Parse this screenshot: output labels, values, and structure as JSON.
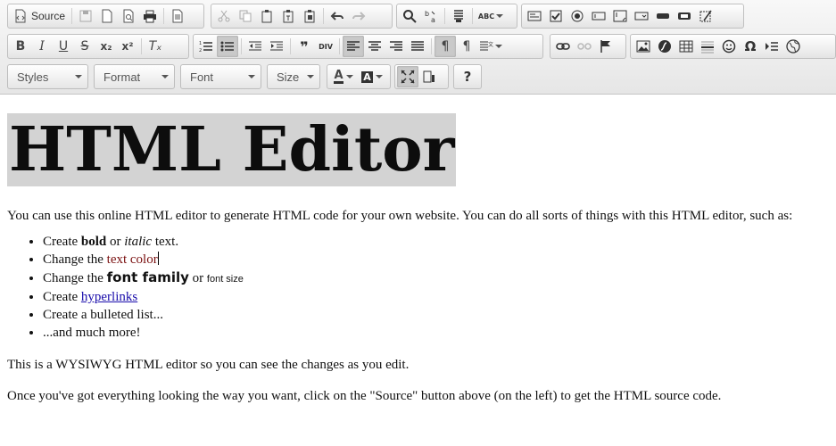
{
  "toolbar": {
    "source_label": "Source",
    "styles_label": "Styles",
    "format_label": "Format",
    "font_label": "Font",
    "size_label": "Size",
    "help_label": "?",
    "text_color_glyph": "A",
    "bg_color_glyph": "A",
    "omega_glyph": "Ω",
    "bold_glyph": "B",
    "italic_glyph": "I",
    "underline_glyph": "U",
    "strike_glyph": "S",
    "subscript_glyph": "x₂",
    "superscript_glyph": "x²",
    "removeformat_glyph": "Tₓ",
    "quote_glyph": "❞",
    "div_glyph": "DIV",
    "spellcheck_glyph": "ABC",
    "ltr_glyph": "¶",
    "rtl_glyph": "¶"
  },
  "content": {
    "heading": "HTML Editor",
    "intro": "You can use this online HTML editor to generate HTML code for your own website. You can do all sorts of things with this HTML editor, such as:",
    "list": {
      "item1": {
        "pre": "Create ",
        "bold": "bold",
        "mid": " or ",
        "italic": "italic",
        "post": " text."
      },
      "item2": {
        "pre": "Change the ",
        "colored": "text color"
      },
      "item3": {
        "pre": "Change the ",
        "family": "font family",
        "mid": " or ",
        "size": "font size"
      },
      "item4": {
        "pre": "Create ",
        "link": "hyperlinks"
      },
      "item5": "Create a bulleted list...",
      "item6": "...and much more!"
    },
    "para2": "This is a WYSIWYG HTML editor so you can see the changes as you edit.",
    "para3": "Once you've got everything looking the way you want, click on the \"Source\" button above (on the left) to get the HTML source code."
  },
  "colors": {
    "toolbar_bg": "#e6e6e6",
    "text_color_sample": "#7a1010",
    "link": "#1a0dab",
    "heading_highlight": "#d3d3d3"
  }
}
